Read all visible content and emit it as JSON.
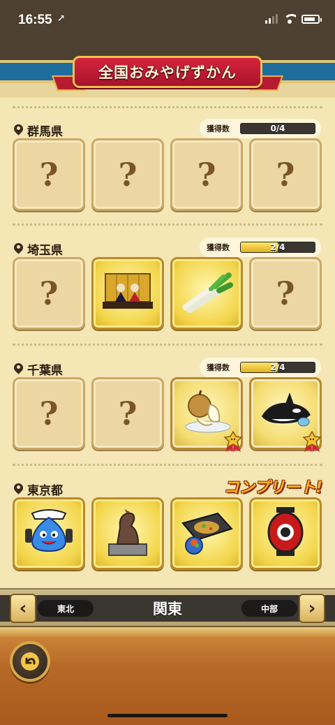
{
  "status_bar": {
    "time": "16:55",
    "location_arrow": "➚"
  },
  "header": {
    "title": "全国おみやげずかん"
  },
  "progress_label": "獲得数",
  "sections": [
    {
      "name": "群馬県",
      "progress_text": "0/4",
      "progress_fraction": 0,
      "complete": false,
      "tiles": [
        {
          "state": "unknown",
          "label": "?"
        },
        {
          "state": "unknown",
          "label": "?"
        },
        {
          "state": "unknown",
          "label": "?"
        },
        {
          "state": "unknown",
          "label": "?"
        }
      ]
    },
    {
      "name": "埼玉県",
      "progress_text": "2/4",
      "progress_fraction": 0.5,
      "complete": false,
      "tiles": [
        {
          "state": "unknown",
          "label": "?"
        },
        {
          "state": "got",
          "icon": "hina-doll-icon"
        },
        {
          "state": "got",
          "icon": "green-onion-icon"
        },
        {
          "state": "unknown",
          "label": "?"
        }
      ]
    },
    {
      "name": "千葉県",
      "progress_text": "2/4",
      "progress_fraction": 0.5,
      "complete": false,
      "tiles": [
        {
          "state": "unknown",
          "label": "?"
        },
        {
          "state": "unknown",
          "label": "?"
        },
        {
          "state": "gold",
          "icon": "pear-icon"
        },
        {
          "state": "gold",
          "icon": "orca-icon"
        }
      ]
    },
    {
      "name": "東京都",
      "complete": true,
      "complete_label": "コンプリート!",
      "tiles": [
        {
          "state": "got",
          "icon": "slime-maid-icon"
        },
        {
          "state": "got",
          "icon": "hachiko-statue-icon"
        },
        {
          "state": "got",
          "icon": "monjayaki-icon"
        },
        {
          "state": "got",
          "icon": "lantern-icon"
        }
      ]
    }
  ],
  "nav": {
    "prev_region": "東北",
    "current_region": "関東",
    "next_region": "中部"
  },
  "colors": {
    "banner": "#c01c36",
    "sky_stripe": "#1f6d9c",
    "parchment": "#f5e6b5",
    "bar_fill": "#f0c834"
  }
}
